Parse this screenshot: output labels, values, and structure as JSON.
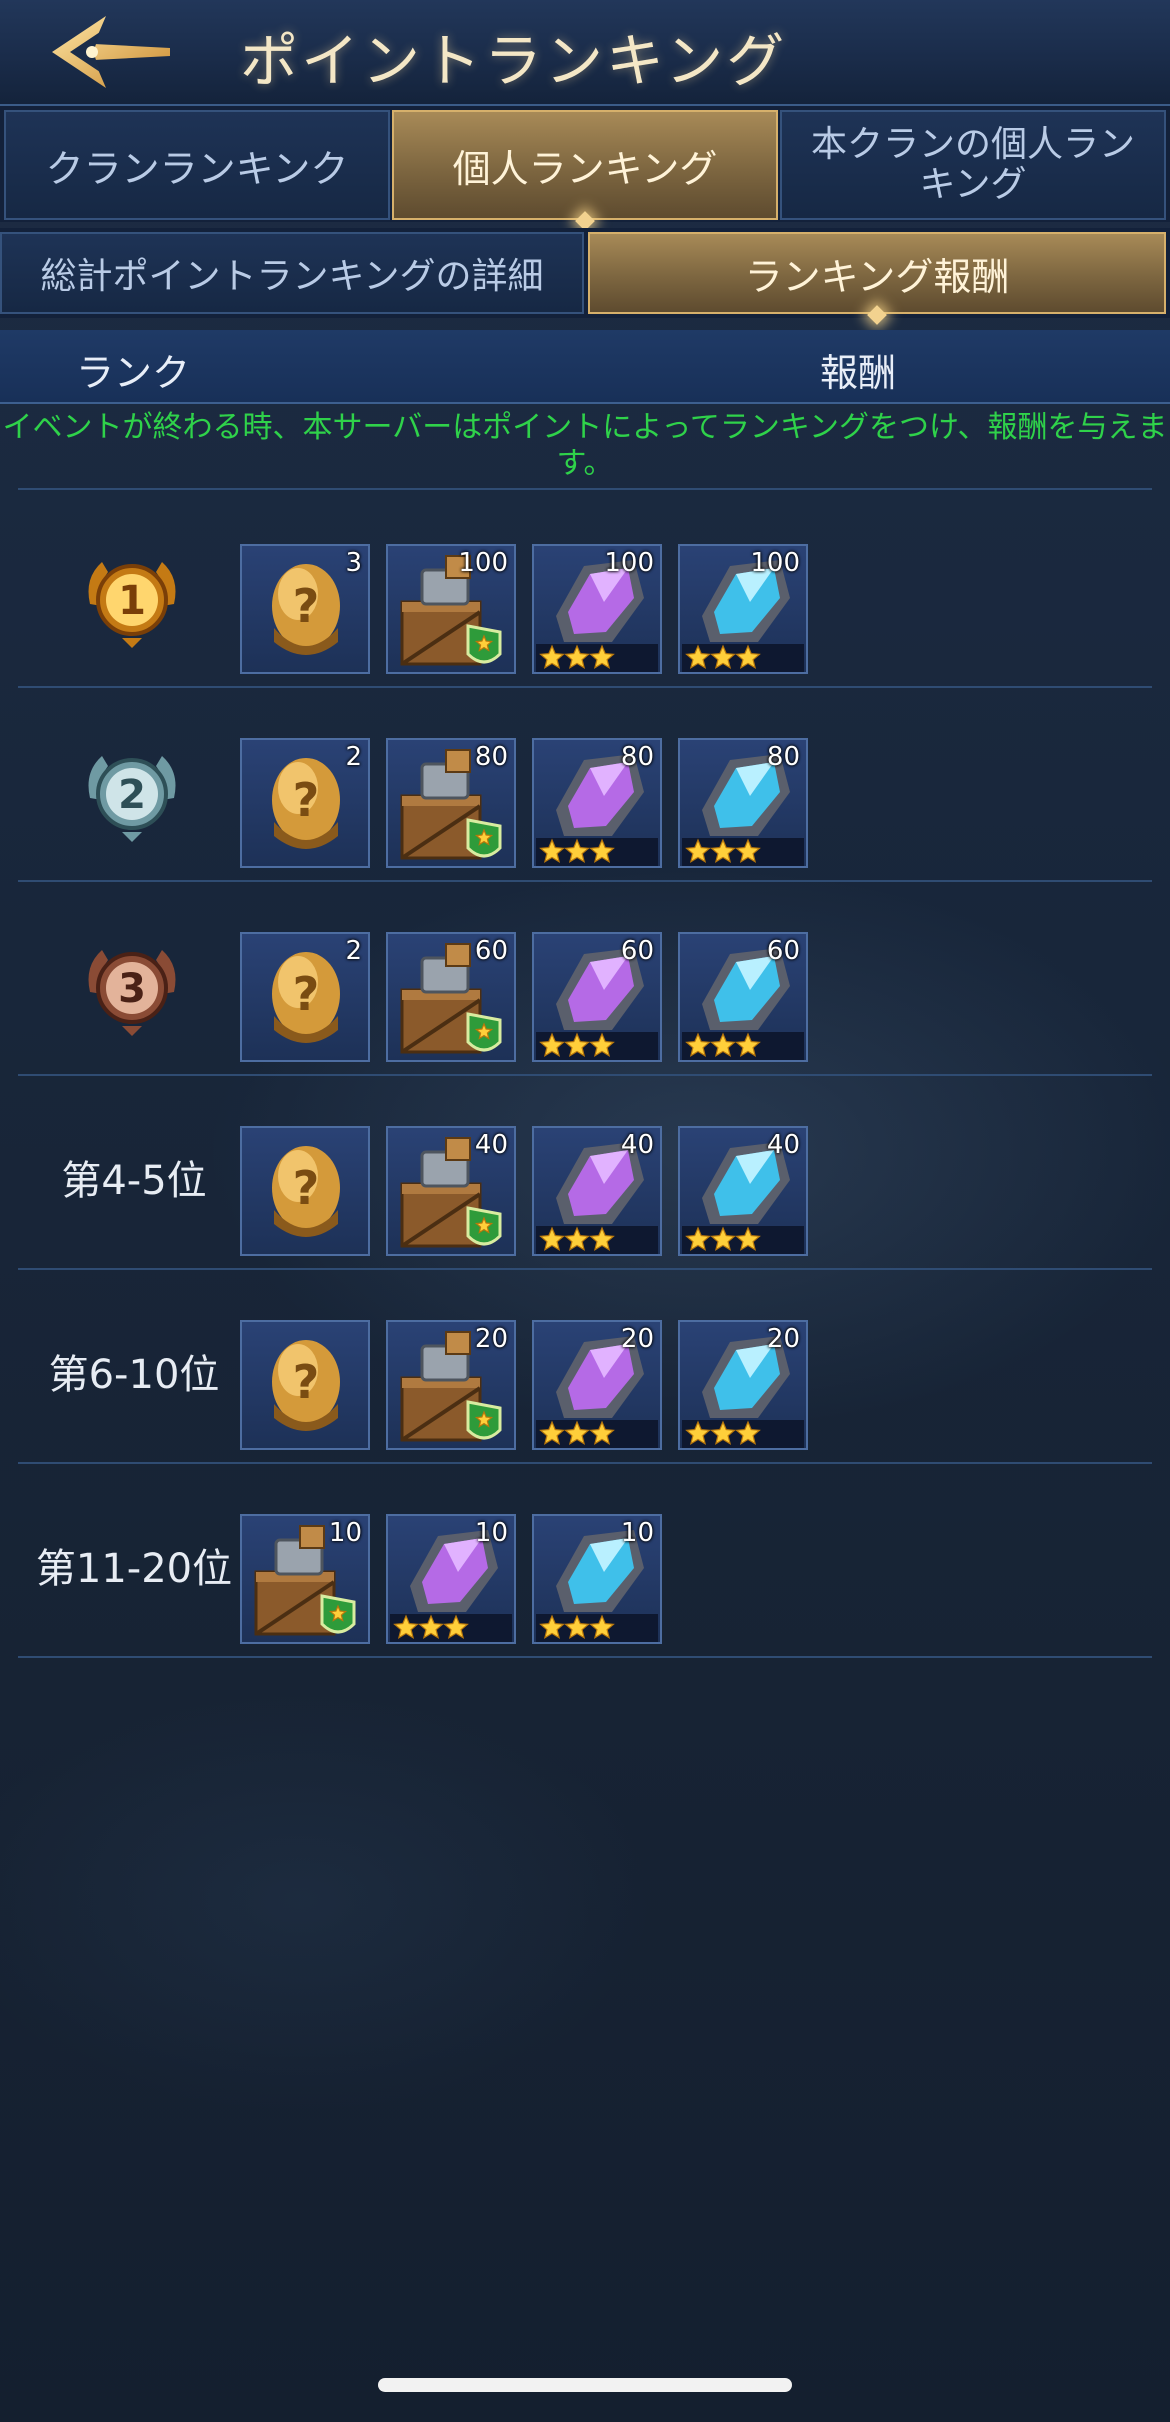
{
  "header": {
    "title": "ポイントランキング"
  },
  "tabs_primary": [
    {
      "label": "クランランキンク",
      "active": false
    },
    {
      "label": "個人ランキング",
      "active": true
    },
    {
      "label": "本クランの個人ランキング",
      "active": false
    }
  ],
  "tabs_secondary": [
    {
      "label": "総計ポイントランキングの詳細",
      "active": false
    },
    {
      "label": "ランキング報酬",
      "active": true
    }
  ],
  "columns": {
    "rank": "ランク",
    "reward": "報酬"
  },
  "notice": "イベントが終わる時、本サーバーはポイントによってランキングをつけ、報酬を与えます。",
  "colors": {
    "notice": "#2fd24a",
    "active_tab": "#a88a57",
    "gold": "#d6b06b"
  },
  "rows": [
    {
      "rank": "1",
      "medal": "gold-medal-icon",
      "rewards": [
        {
          "icon": "mystery-egg-icon",
          "count": "3"
        },
        {
          "icon": "equipment-crate-icon",
          "count": "100"
        },
        {
          "icon": "purple-crystal-icon",
          "count": "100",
          "stars": 3
        },
        {
          "icon": "blue-crystal-icon",
          "count": "100",
          "stars": 3
        }
      ]
    },
    {
      "rank": "2",
      "medal": "silver-medal-icon",
      "rewards": [
        {
          "icon": "mystery-egg-icon",
          "count": "2"
        },
        {
          "icon": "equipment-crate-icon",
          "count": "80"
        },
        {
          "icon": "purple-crystal-icon",
          "count": "80",
          "stars": 3
        },
        {
          "icon": "blue-crystal-icon",
          "count": "80",
          "stars": 3
        }
      ]
    },
    {
      "rank": "3",
      "medal": "bronze-medal-icon",
      "rewards": [
        {
          "icon": "mystery-egg-icon",
          "count": "2"
        },
        {
          "icon": "equipment-crate-icon",
          "count": "60"
        },
        {
          "icon": "purple-crystal-icon",
          "count": "60",
          "stars": 3
        },
        {
          "icon": "blue-crystal-icon",
          "count": "60",
          "stars": 3
        }
      ]
    },
    {
      "rank": "第4-5位",
      "rewards": [
        {
          "icon": "mystery-egg-icon",
          "count": ""
        },
        {
          "icon": "equipment-crate-icon",
          "count": "40"
        },
        {
          "icon": "purple-crystal-icon",
          "count": "40",
          "stars": 3
        },
        {
          "icon": "blue-crystal-icon",
          "count": "40",
          "stars": 3
        }
      ]
    },
    {
      "rank": "第6-10位",
      "rewards": [
        {
          "icon": "mystery-egg-icon",
          "count": ""
        },
        {
          "icon": "equipment-crate-icon",
          "count": "20"
        },
        {
          "icon": "purple-crystal-icon",
          "count": "20",
          "stars": 3
        },
        {
          "icon": "blue-crystal-icon",
          "count": "20",
          "stars": 3
        }
      ]
    },
    {
      "rank": "第11-20位",
      "rewards": [
        {
          "icon": "equipment-crate-icon",
          "count": "10"
        },
        {
          "icon": "purple-crystal-icon",
          "count": "10",
          "stars": 3
        },
        {
          "icon": "blue-crystal-icon",
          "count": "10",
          "stars": 3
        }
      ]
    }
  ]
}
